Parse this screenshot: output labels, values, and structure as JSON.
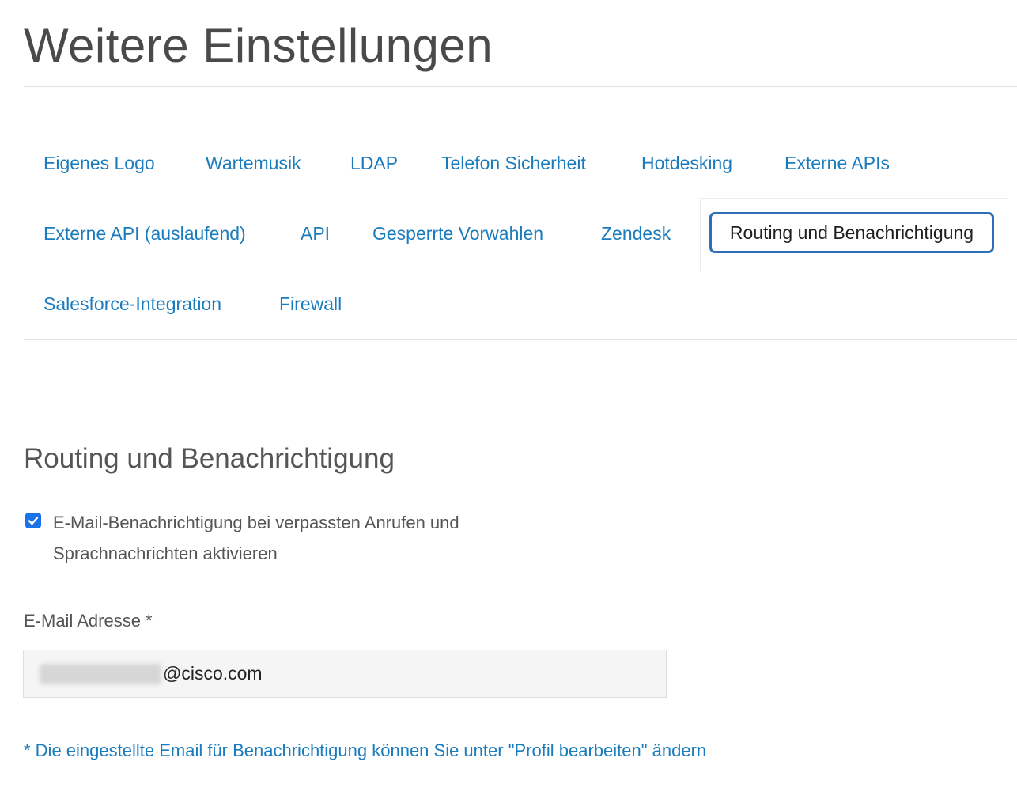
{
  "page": {
    "title": "Weitere Einstellungen"
  },
  "tabs": {
    "row1": [
      {
        "label": "Eigenes Logo"
      },
      {
        "label": "Wartemusik"
      },
      {
        "label": "LDAP"
      },
      {
        "label": "Telefon Sicherheit"
      },
      {
        "label": "Hotdesking"
      },
      {
        "label": "Externe APIs"
      }
    ],
    "row2": [
      {
        "label": "Externe API (auslaufend)"
      },
      {
        "label": "API"
      },
      {
        "label": "Gesperrte Vorwahlen"
      },
      {
        "label": "Zendesk"
      }
    ],
    "active": {
      "label": "Routing und Benachrichtigung"
    },
    "row3": [
      {
        "label": "Salesforce-Integration"
      },
      {
        "label": "Firewall"
      }
    ]
  },
  "section": {
    "title": "Routing und Benachrichtigung",
    "notification_checkbox": {
      "checked": true,
      "label": "E-Mail-Benachrichtigung bei verpassten Anrufen und Sprachnachrichten aktivieren"
    },
    "email": {
      "label": "E-Mail Adresse *",
      "value_visible_suffix": "@cisco.com"
    },
    "footnote": "* Die eingestellte Email für Benachrichtigung können Sie unter \"Profil bearbeiten\" ändern"
  },
  "colors": {
    "link": "#1a7bbd",
    "active_border": "#2f6fb5",
    "checkbox": "#1a73e8"
  }
}
